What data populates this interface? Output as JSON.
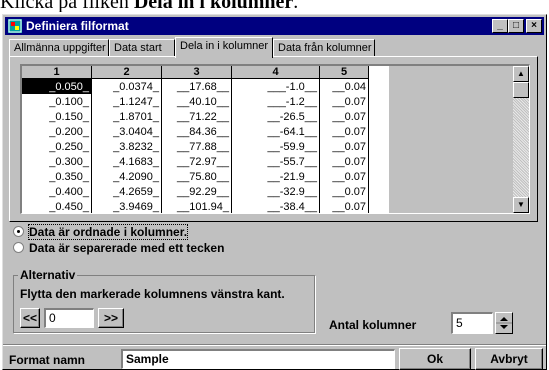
{
  "page_text": {
    "before": "Klicka på fliken ",
    "bold": "Dela in i kolumner",
    "after": "."
  },
  "window": {
    "title": "Definiera filformat",
    "controls": [
      "minimize-icon",
      "maximize-icon",
      "close-icon"
    ]
  },
  "tabs": [
    {
      "label": "Allmänna uppgifter",
      "active": false
    },
    {
      "label": "Data start",
      "active": false
    },
    {
      "label": "Dela in i kolumner",
      "active": true
    },
    {
      "label": "Data från kolumner",
      "active": false
    }
  ],
  "grid": {
    "headers": [
      "1",
      "2",
      "3",
      "4",
      "5"
    ],
    "rows": [
      [
        "_0.050_",
        "_0.0374_",
        "__17.68__",
        "___-1.0__",
        "__0.04"
      ],
      [
        "_0.100_",
        "_1.1247_",
        "__40.10__",
        "___-1.2__",
        "__0.07"
      ],
      [
        "_0.150_",
        "_1.8701_",
        "__71.22__",
        "__-26.5__",
        "__0.07"
      ],
      [
        "_0.200_",
        "_3.0404_",
        "__84.36__",
        "__-64.1__",
        "__0.07"
      ],
      [
        "_0.250_",
        "_3.8232_",
        "__77.88__",
        "__-59.9__",
        "__0.07"
      ],
      [
        "_0.300_",
        "_4.1683_",
        "__72.97__",
        "__-55.7__",
        "__0.07"
      ],
      [
        "_0.350_",
        "_4.2090_",
        "__75.80__",
        "__-21.9__",
        "__0.07"
      ],
      [
        "_0.400_",
        "_4.2659_",
        "__92.29__",
        "__-32.9__",
        "__0.07"
      ],
      [
        "_0.450_",
        "_3.9469_",
        "__101.94_",
        "__-38.4__",
        "__0.07"
      ]
    ],
    "selected_cell": "_0.050_"
  },
  "options": {
    "option1": {
      "label": "Data är ordnade i kolumner.",
      "selected": true
    },
    "option2": {
      "label": "Data är separerade med ett tecken",
      "selected": false
    }
  },
  "alternativ": {
    "legend": "Alternativ",
    "text": "Flytta den markerade kolumnens vänstra kant.",
    "left_button": "<<",
    "value": "0",
    "right_button": ">>"
  },
  "antal": {
    "label": "Antal kolumner",
    "value": "5"
  },
  "footer": {
    "format_label": "Format namn",
    "format_value": "Sample",
    "ok_label": "Ok",
    "cancel_label": "Avbryt"
  },
  "colors": {
    "titlebar": "#000080",
    "face": "#c0c0c0",
    "selection": "#000000"
  }
}
